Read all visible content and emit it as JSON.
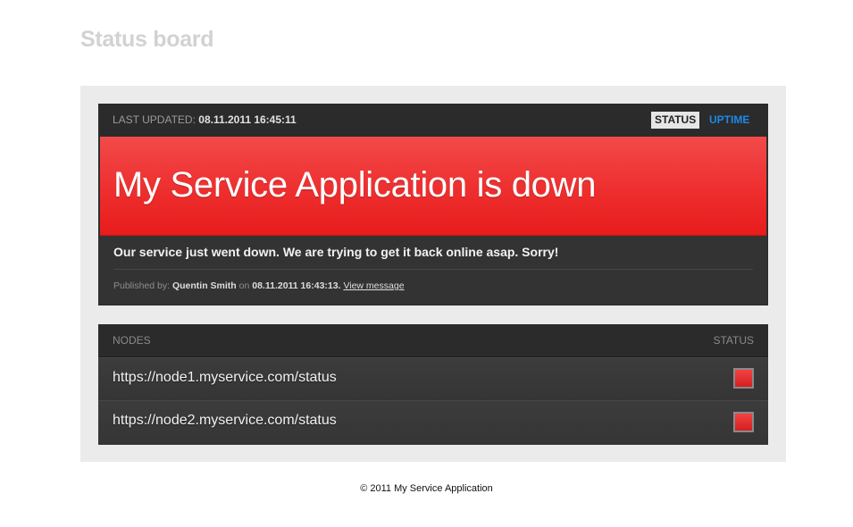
{
  "page": {
    "title": "Status board"
  },
  "status_card": {
    "last_updated_label": "LAST UPDATED:",
    "last_updated_value": "08.11.2011 16:45:11",
    "tabs": [
      {
        "label": "STATUS",
        "active": true
      },
      {
        "label": "UPTIME",
        "active": false
      }
    ],
    "banner_title": "My Service Application is down",
    "banner_color": "#ee2e2e",
    "message": "Our service just went down. We are trying to get it back online asap. Sorry!",
    "published_by_label": "Published by:",
    "author": "Quentin Smith",
    "on_label": "on",
    "published_at": "08.11.2011 16:43:13.",
    "view_message_label": "View message"
  },
  "nodes": {
    "header_nodes": "NODES",
    "header_status": "STATUS",
    "rows": [
      {
        "url": "https://node1.myservice.com/status",
        "status": "down",
        "status_color": "#e62a2a"
      },
      {
        "url": "https://node2.myservice.com/status",
        "status": "down",
        "status_color": "#e62a2a"
      }
    ]
  },
  "footer": {
    "text": "© 2011 My Service Application"
  }
}
